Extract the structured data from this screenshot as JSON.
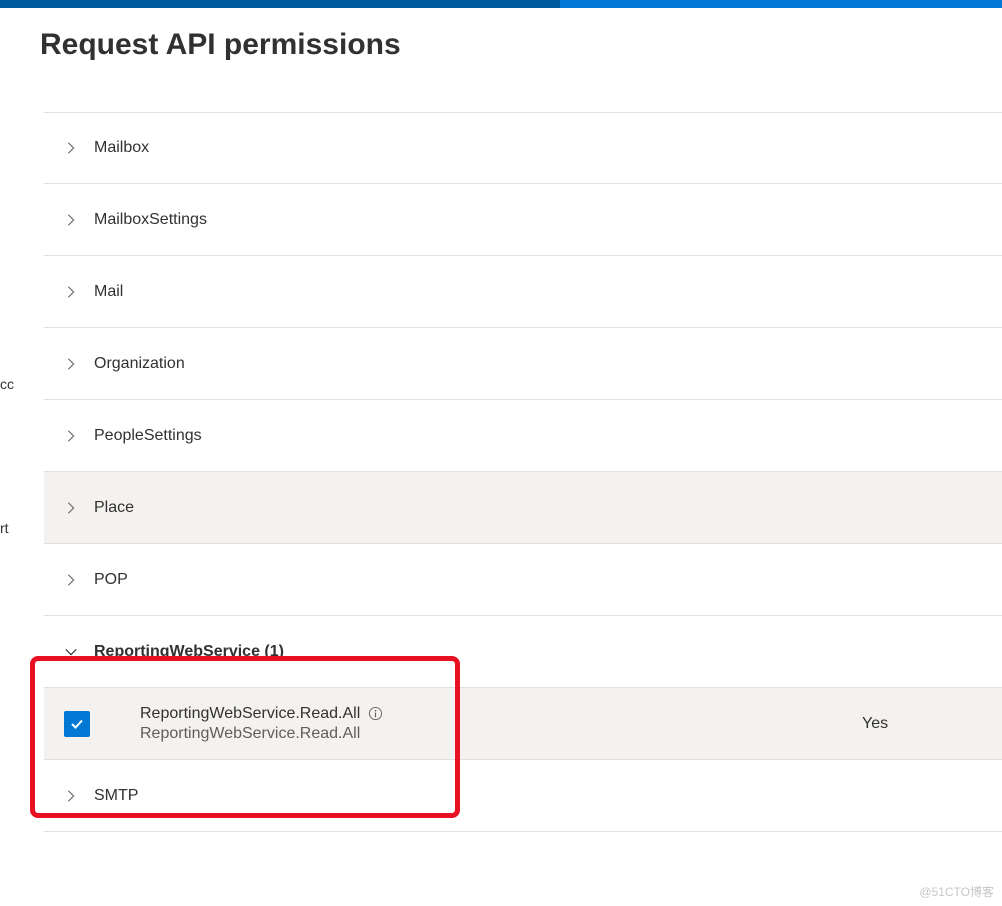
{
  "header": {
    "title": "Request API permissions"
  },
  "sidebar_fragments": {
    "f1": "cc",
    "f2": "rt"
  },
  "categories": [
    {
      "label": "Mailbox",
      "expanded": false,
      "selected": false
    },
    {
      "label": "MailboxSettings",
      "expanded": false,
      "selected": false
    },
    {
      "label": "Mail",
      "expanded": false,
      "selected": false
    },
    {
      "label": "Organization",
      "expanded": false,
      "selected": false
    },
    {
      "label": "PeopleSettings",
      "expanded": false,
      "selected": false
    },
    {
      "label": "Place",
      "expanded": false,
      "selected": true
    },
    {
      "label": "POP",
      "expanded": false,
      "selected": false
    },
    {
      "label": "ReportingWebService (1)",
      "expanded": true,
      "selected": false
    },
    {
      "label": "SMTP",
      "expanded": false,
      "selected": false
    }
  ],
  "permission": {
    "name": "ReportingWebService.Read.All",
    "description": "ReportingWebService.Read.All",
    "admin_consent": "Yes",
    "checked": true
  },
  "watermark": "@51CTO博客"
}
